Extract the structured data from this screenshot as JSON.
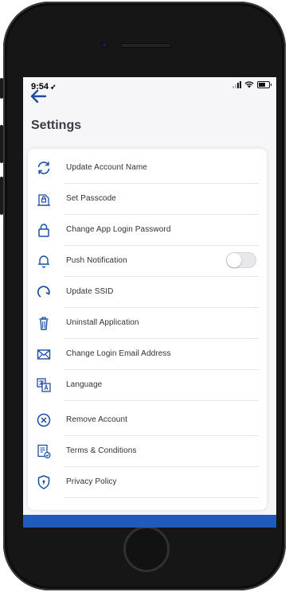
{
  "status_bar": {
    "time": "9:54",
    "location_glyph": "➶"
  },
  "header": {
    "back_icon": "arrow-left-icon",
    "title": "Settings"
  },
  "colors": {
    "accent": "#1f5bbf",
    "icon_blue": "#1f4ea0",
    "background": "#f6f6f8"
  },
  "settings": {
    "items": [
      {
        "label": "Update Account Name",
        "icon": "refresh-icon"
      },
      {
        "label": "Set Passcode",
        "icon": "passcode-icon"
      },
      {
        "label": "Change App Login Password",
        "icon": "lock-icon"
      },
      {
        "label": "Push Notification",
        "icon": "bell-icon",
        "toggle_on": false
      },
      {
        "label": "Update SSID",
        "icon": "rotate-icon"
      },
      {
        "label": "Uninstall Application",
        "icon": "trash-icon"
      },
      {
        "label": "Change Login Email Address",
        "icon": "envelope-icon"
      },
      {
        "label": "Language",
        "icon": "language-icon"
      },
      {
        "label": "Remove Account",
        "icon": "remove-circle-icon"
      },
      {
        "label": "Terms & Conditions",
        "icon": "document-check-icon"
      },
      {
        "label": "Privacy Policy",
        "icon": "shield-icon"
      }
    ]
  }
}
